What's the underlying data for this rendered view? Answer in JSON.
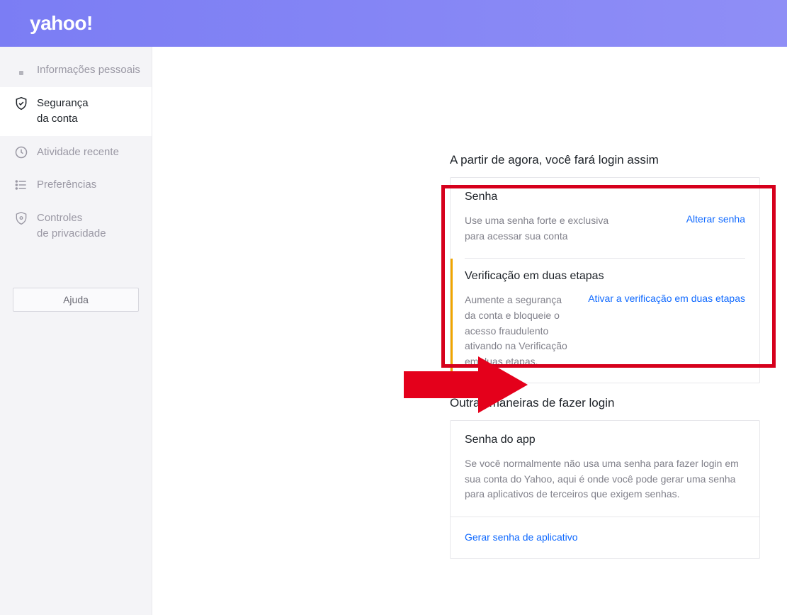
{
  "brand": "yahoo!",
  "sidebar": {
    "items": [
      {
        "label": "Informações pessoais"
      },
      {
        "label_line1": "Segurança",
        "label_line2": "da conta"
      },
      {
        "label": "Atividade recente"
      },
      {
        "label": "Preferências"
      },
      {
        "label_line1": "Controles",
        "label_line2": "de privacidade"
      }
    ],
    "help_label": "Ajuda"
  },
  "main": {
    "login_section_title": "A partir de agora, você fará login assim",
    "password_card": {
      "title": "Senha",
      "description": "Use uma senha forte e exclusiva para acessar sua conta",
      "link": "Alterar senha"
    },
    "two_step_card": {
      "title": "Verificação em duas etapas",
      "description": "Aumente a segurança da conta e bloqueie o acesso fraudulento ativando na Verificação em duas etapas.",
      "link": "Ativar a verificação em duas etapas"
    },
    "other_ways_title": "Outras maneiras de fazer login",
    "app_password_card": {
      "title": "Senha do app",
      "description": "Se você normalmente não usa uma senha para fazer login em sua conta do Yahoo, aqui é onde você pode gerar uma senha para aplicativos de terceiros que exigem senhas.",
      "link": "Gerar senha de aplicativo"
    }
  },
  "colors": {
    "accent": "#0f69ff",
    "header_gradient_start": "#7b7df4",
    "header_gradient_end": "#8f8ef6",
    "highlight_border": "#d6001c",
    "two_step_stripe": "#f0a500"
  }
}
